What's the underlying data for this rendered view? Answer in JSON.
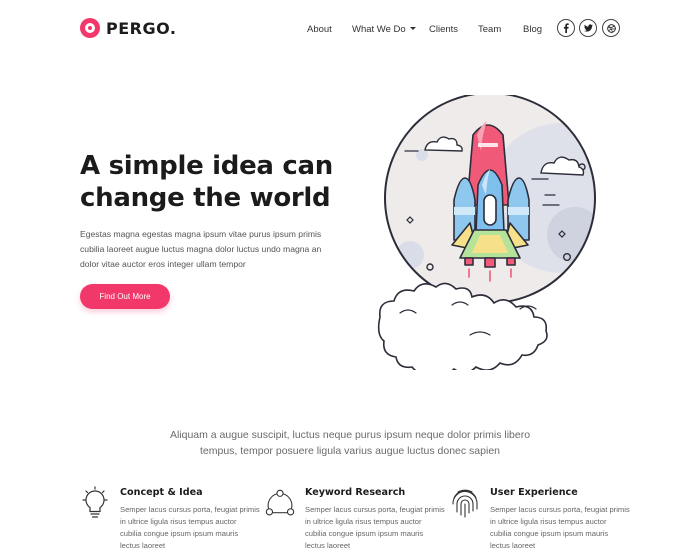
{
  "brand": {
    "name": "PERGO."
  },
  "nav": {
    "items": [
      {
        "label": "About"
      },
      {
        "label": "What We Do"
      },
      {
        "label": "Clients"
      },
      {
        "label": "Team"
      },
      {
        "label": "Blog"
      }
    ]
  },
  "social": [
    {
      "icon": "facebook-icon",
      "glyph": "f"
    },
    {
      "icon": "twitter-icon",
      "glyph": "❦"
    },
    {
      "icon": "dribbble-icon",
      "glyph": "◎"
    }
  ],
  "hero": {
    "title_line1": "A simple idea can",
    "title_line2": "change the world",
    "text": "Egestas magna egestas magna ipsum vitae purus ipsum primis cubilia laoreet augue luctus magna dolor luctus undo magna an dolor vitae auctor eros integer ullam tempor",
    "cta_label": "Find Out More"
  },
  "tagline": {
    "line1": "Aliquam a augue suscipit, luctus neque purus ipsum neque dolor primis libero",
    "line2": "tempus, tempor posuere ligula varius augue luctus donec sapien"
  },
  "features": [
    {
      "icon": "lightbulb-icon",
      "title": "Concept & Idea",
      "text": "Semper lacus cursus porta, feugiat primis in ultrice ligula risus tempus auctor cubilia congue ipsum ipsum mauris lectus laoreet"
    },
    {
      "icon": "network-icon",
      "title": "Keyword Research",
      "text": "Semper lacus cursus porta, feugiat primis in ultrice ligula risus tempus auctor cubilia congue ipsum ipsum mauris lectus laoreet"
    },
    {
      "icon": "fingerprint-icon",
      "title": "User Experience",
      "text": "Semper lacus cursus porta, feugiat primis in ultrice ligula risus tempus auctor cubilia congue ipsum ipsum mauris lectus laoreet"
    }
  ],
  "colors": {
    "accent": "#f2386a",
    "moon": "#eeeaea",
    "rocket_body": "#f05a78",
    "booster_blue": "#8ec8ef",
    "booster_yellow": "#f7e08a",
    "booster_green": "#b5e39a"
  }
}
